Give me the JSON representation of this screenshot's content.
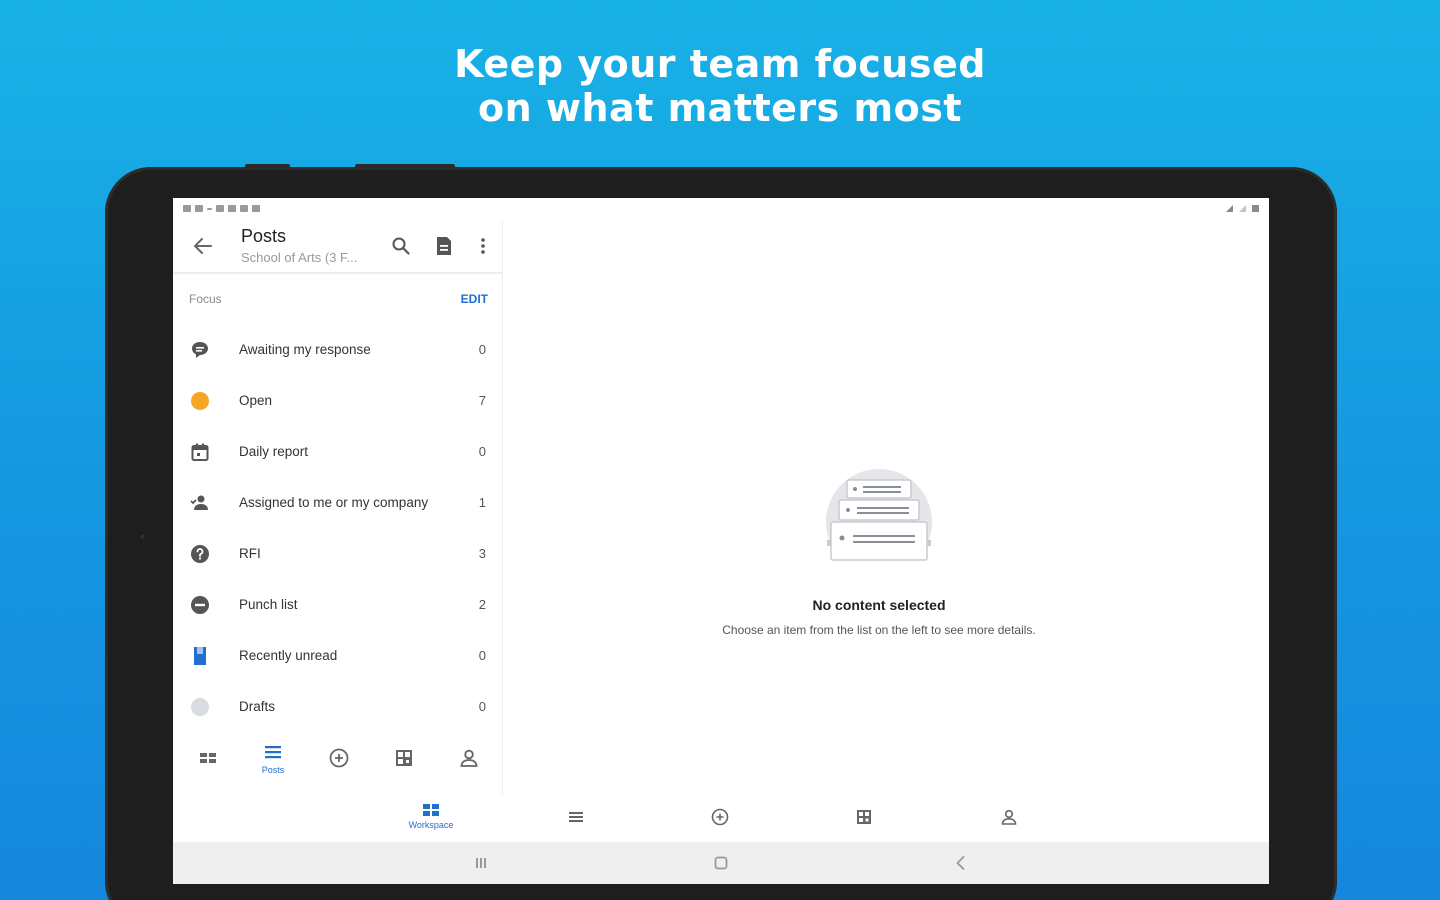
{
  "headline": {
    "line1": "Keep your team focused",
    "line2": "on what matters most"
  },
  "appbar": {
    "title": "Posts",
    "subtitle": "School of Arts (3 F...",
    "icons": [
      "back-arrow-icon",
      "search-icon",
      "document-icon",
      "more-vert-icon"
    ]
  },
  "focus": {
    "label": "Focus",
    "edit": "EDIT"
  },
  "focus_items": [
    {
      "label": "Awaiting my response",
      "count": "0",
      "icon": "chat-bubble-icon"
    },
    {
      "label": "Open",
      "count": "7",
      "icon": "open-status-dot-icon"
    },
    {
      "label": "Daily report",
      "count": "0",
      "icon": "calendar-icon"
    },
    {
      "label": "Assigned to me or my company",
      "count": "1",
      "icon": "assigned-person-icon"
    },
    {
      "label": "RFI",
      "count": "3",
      "icon": "question-circle-icon"
    },
    {
      "label": "Punch list",
      "count": "2",
      "icon": "minus-circle-icon"
    },
    {
      "label": "Recently unread",
      "count": "0",
      "icon": "bookmark-icon"
    },
    {
      "label": "Drafts",
      "count": "0",
      "icon": "draft-dot-icon"
    }
  ],
  "inner_nav": {
    "posts_label": "Posts"
  },
  "empty_state": {
    "title": "No content selected",
    "description": "Choose an item from the list on the left to see more details."
  },
  "bottom_nav": {
    "workspace_label": "Workspace"
  },
  "colors": {
    "accent": "#1f6fd1",
    "open_status": "#f5a623",
    "draft_status": "#d8dce0"
  }
}
